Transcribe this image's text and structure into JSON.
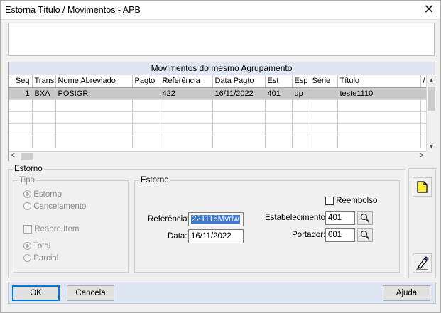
{
  "window": {
    "title": "Estorna Título / Movimentos  -  APB",
    "close_glyph": "✕"
  },
  "grid": {
    "caption": "Movimentos do mesmo Agrupamento",
    "columns": [
      "Seq",
      "Trans",
      "Nome Abreviado",
      "Pagto",
      "Referência",
      "Data Pagto",
      "Est",
      "Esp",
      "Série",
      "Título",
      "/"
    ],
    "rows": [
      [
        "1",
        "BXA",
        "POSIGR",
        "",
        "422",
        "16/11/2022",
        "401",
        "dp",
        "",
        "teste1110",
        ""
      ]
    ],
    "empty_row_count": 5
  },
  "estorno_group": {
    "legend": "Estorno",
    "tipo": {
      "legend": "Tipo",
      "options": [
        "Estorno",
        "Cancelamento"
      ],
      "selected": "Estorno",
      "reabre_item_label": "Reabre Item",
      "scope_options": [
        "Total",
        "Parcial"
      ],
      "scope_selected": "Total"
    },
    "detail": {
      "legend": "Estorno",
      "reembolso_label": "Reembolso",
      "referencia_label": "Referência:",
      "referencia_value": "221116Mvdw",
      "data_label": "Data:",
      "data_value": "16/11/2022",
      "estabelecimento_label": "Estabelecimento:",
      "estabelecimento_value": "401",
      "portador_label": "Portador:",
      "portador_value": "001"
    }
  },
  "side_tools": {
    "new_icon": "new-document-icon",
    "edit_icon": "edit-pen-icon"
  },
  "footer": {
    "ok_label": "OK",
    "cancel_label": "Cancela",
    "help_label": "Ajuda"
  },
  "colors": {
    "grid_caption_bg": "#dde6f2",
    "selected_row_bg": "#c8c8c8",
    "footer_bg": "#dde6f2",
    "highlight_text_bg": "#3b79d6",
    "default_button_border": "#0078d7"
  }
}
